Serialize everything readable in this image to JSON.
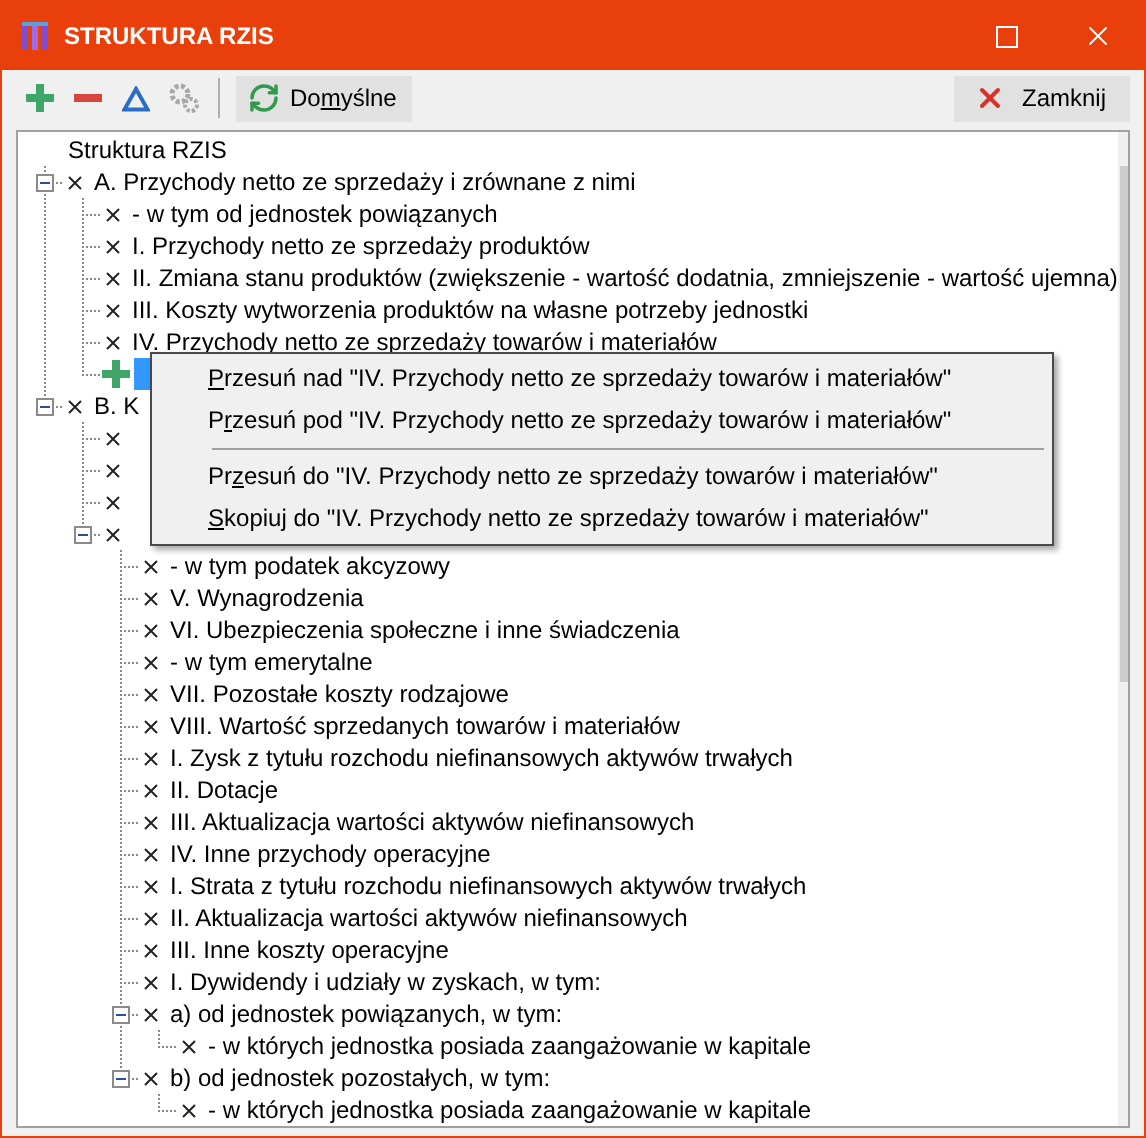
{
  "window": {
    "title": "STRUKTURA RZIS"
  },
  "toolbar": {
    "tools": [
      {
        "kind": "add",
        "disabled": false
      },
      {
        "kind": "remove",
        "disabled": false
      },
      {
        "kind": "delta",
        "disabled": false
      },
      {
        "kind": "settings",
        "disabled": true
      }
    ],
    "default_button": {
      "pre": "Do",
      "key": "m",
      "post": "yślne"
    },
    "close_button": {
      "label": "Zamknij"
    }
  },
  "tree": {
    "root": "Struktura RZIS",
    "nodes": [
      {
        "label": "A. Przychody netto ze sprzedaży i zrównane z nimi",
        "expanded": true,
        "children": [
          {
            "label": "- w tym od jednostek powiązanych"
          },
          {
            "label": "I. Przychody netto ze sprzedaży produktów"
          },
          {
            "label": "II. Zmiana stanu produktów (zwiększenie - wartość dodatnia, zmniejszenie - wartość ujemna)"
          },
          {
            "label": "III. Koszty wytworzenia produktów na własne potrzeby jednostki"
          },
          {
            "label": "IV. Przychody netto ze sprzedaży towarów i materiałów"
          },
          {
            "kind": "new",
            "selected": true
          }
        ]
      },
      {
        "label": "B. K",
        "expanded": true,
        "children": [
          {
            "kind": "item"
          },
          {
            "kind": "item"
          },
          {
            "kind": "item"
          },
          {
            "expanded": true,
            "children": [
              {
                "label": "- w tym podatek akcyzowy"
              },
              {
                "label": "V. Wynagrodzenia"
              },
              {
                "label": "VI. Ubezpieczenia społeczne i inne świadczenia"
              },
              {
                "label": "- w tym emerytalne"
              },
              {
                "label": "VII. Pozostałe koszty rodzajowe"
              },
              {
                "label": "VIII. Wartość sprzedanych towarów i materiałów"
              },
              {
                "label": "I. Zysk z tytułu rozchodu niefinansowych aktywów trwałych"
              },
              {
                "label": "II. Dotacje"
              },
              {
                "label": "III. Aktualizacja wartości aktywów niefinansowych"
              },
              {
                "label": "IV. Inne przychody operacyjne"
              },
              {
                "label": "I. Strata z tytułu rozchodu niefinansowych aktywów trwałych"
              },
              {
                "label": "II. Aktualizacja wartości aktywów niefinansowych"
              },
              {
                "label": "III. Inne koszty operacyjne"
              },
              {
                "label": "I. Dywidendy i udziały w zyskach, w tym:"
              },
              {
                "label": "a) od jednostek powiązanych, w tym:",
                "expanded": true,
                "children": [
                  {
                    "label": "- w których jednostka posiada zaangażowanie w kapitale"
                  }
                ]
              },
              {
                "label": "b) od jednostek pozostałych, w tym:",
                "expanded": true,
                "children": [
                  {
                    "label": "- w których jednostka posiada zaangażowanie w kapitale"
                  }
                ]
              }
            ]
          }
        ]
      }
    ]
  },
  "context_menu": {
    "items": [
      {
        "kind": "item",
        "key": "P",
        "post": "rzesuń nad \"IV. Przychody netto ze sprzedaży towarów i materiałów\""
      },
      {
        "kind": "item",
        "pre": "P",
        "key": "r",
        "post": "zesuń pod \"IV. Przychody netto ze sprzedaży towarów i materiałów\""
      },
      {
        "kind": "separator"
      },
      {
        "kind": "item",
        "pre": "Pr",
        "key": "z",
        "post": "esuń do \"IV. Przychody netto ze sprzedaży towarów i materiałów\""
      },
      {
        "kind": "item",
        "key": "S",
        "post": "kopiuj do \"IV. Przychody netto ze sprzedaży towarów i materiałów\""
      }
    ]
  }
}
